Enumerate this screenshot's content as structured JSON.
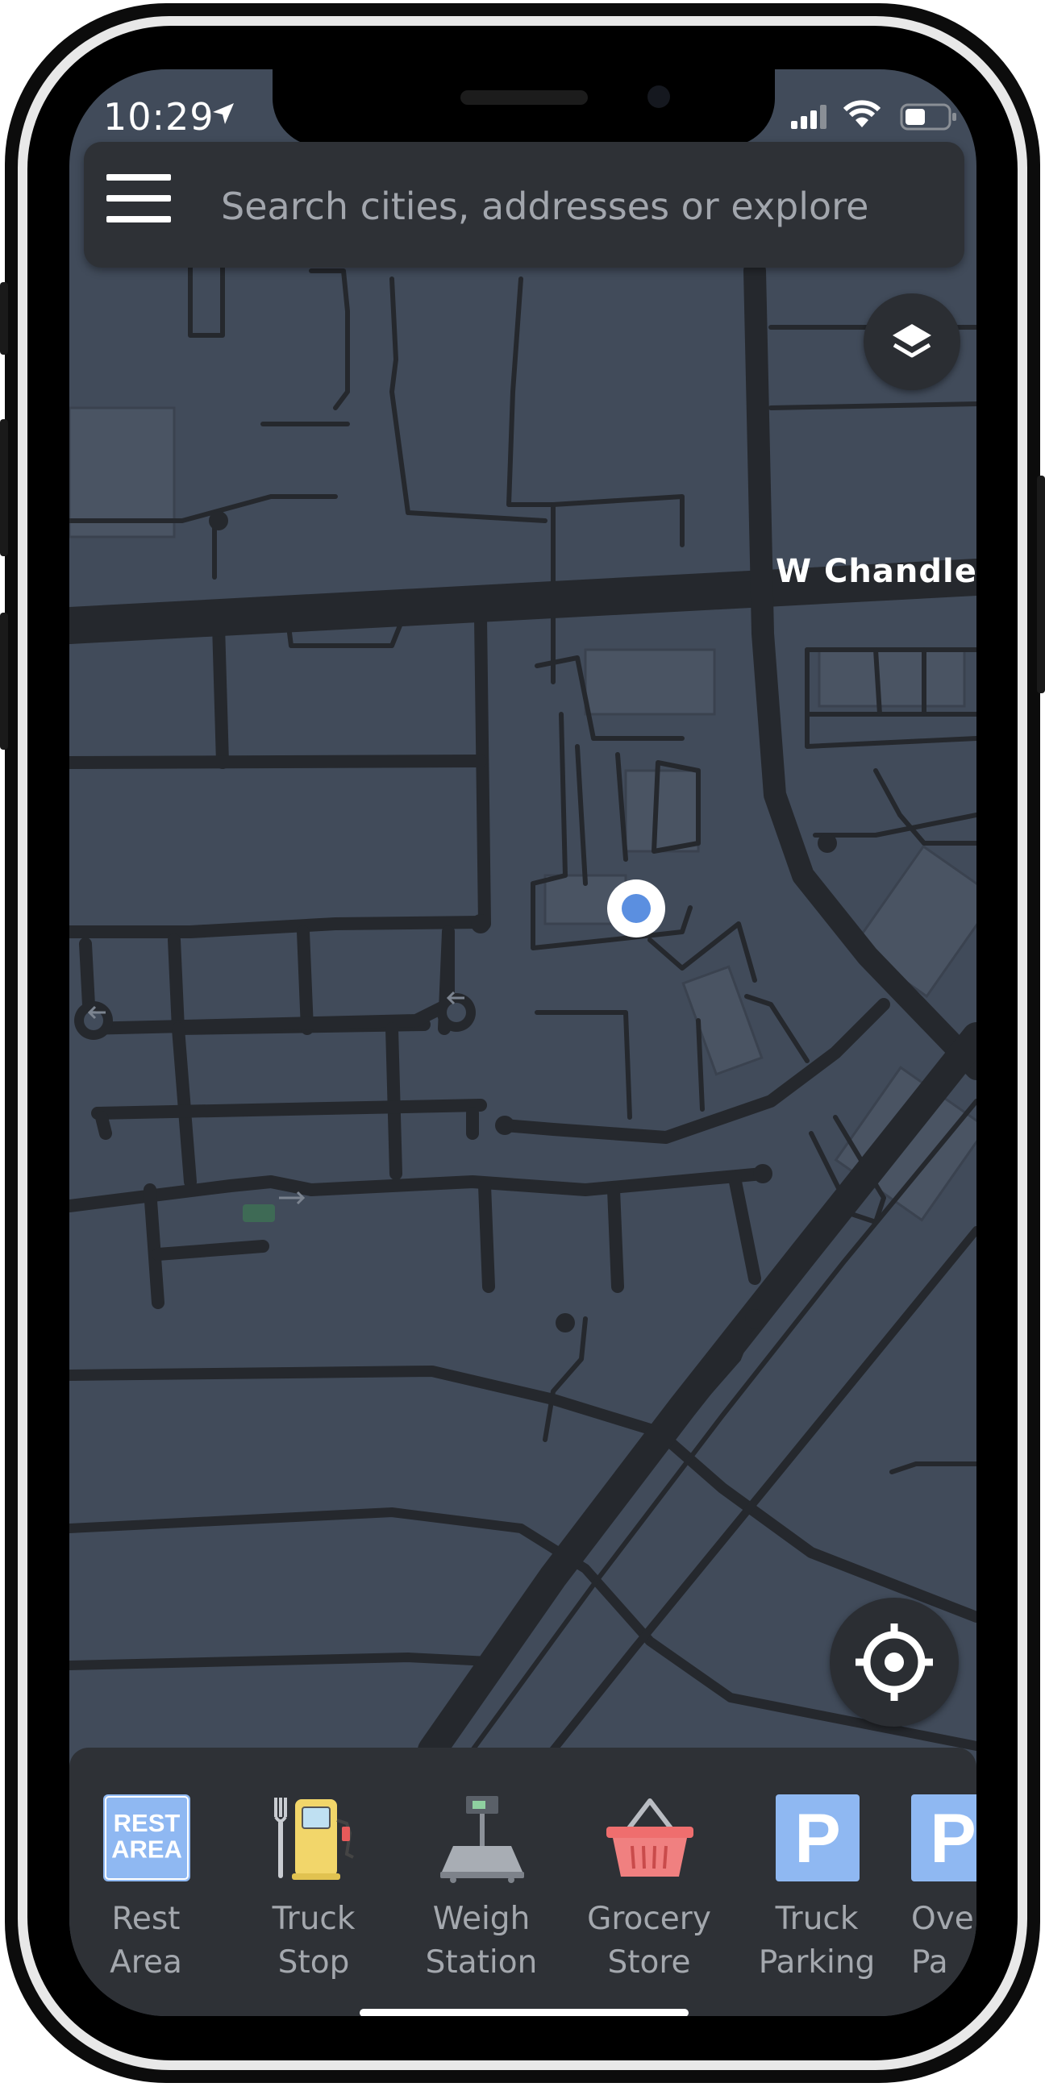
{
  "status_bar": {
    "time": "10:29"
  },
  "search": {
    "placeholder": "Search cities, addresses or explore"
  },
  "map": {
    "street_label": "W Chandler",
    "colors": {
      "background": "#414b5a",
      "road": "#25282d",
      "location_dot": "#5b8fe0"
    }
  },
  "controls": {
    "layers_icon": "layers-icon",
    "recenter_icon": "crosshair-icon"
  },
  "categories": [
    {
      "label": "Rest\nArea",
      "icon": "rest-area-icon",
      "icon_text": "REST\nAREA"
    },
    {
      "label": "Truck\nStop",
      "icon": "fuel-pump-icon"
    },
    {
      "label": "Weigh\nStation",
      "icon": "scale-icon"
    },
    {
      "label": "Grocery\nStore",
      "icon": "basket-icon"
    },
    {
      "label": "Truck\nParking",
      "icon": "parking-icon",
      "icon_text": "P"
    },
    {
      "label": "Over\nPa",
      "icon": "parking-icon",
      "icon_text": "P"
    }
  ]
}
